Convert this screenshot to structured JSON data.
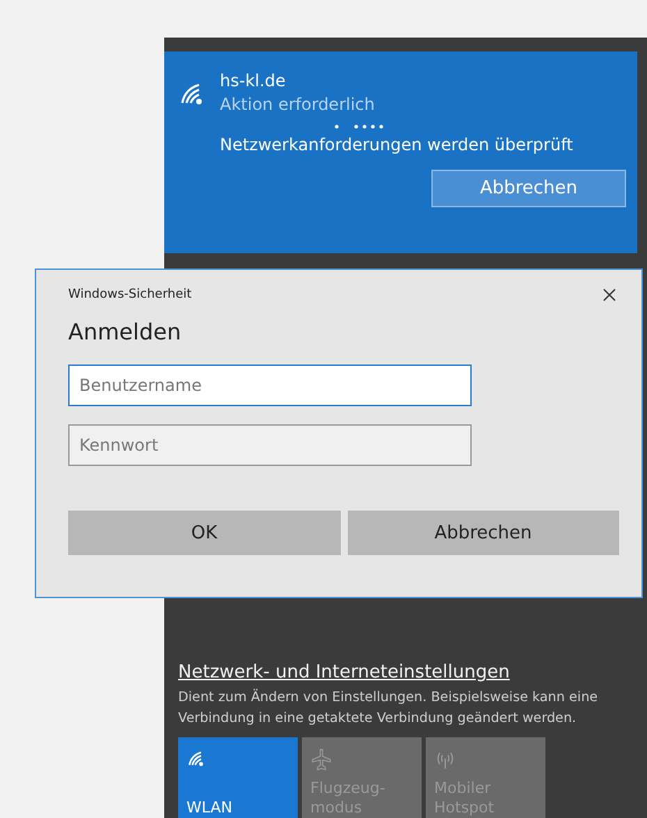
{
  "network": {
    "name": "hs-kl.de",
    "status": "Aktion erforderlich",
    "message": "Netzwerkanforderungen werden überprüft",
    "button": "Abbrechen"
  },
  "dialog": {
    "title": "Windows-Sicherheit",
    "heading": "Anmelden",
    "fields": [
      {
        "placeholder": "Benutzername",
        "focused": true
      },
      {
        "placeholder": "Kennwort",
        "focused": false
      }
    ],
    "buttons": [
      "OK",
      "Abbrechen"
    ]
  },
  "settings": {
    "link": "Netzwerk- und Interneteinstellungen",
    "description": "Dient zum Ändern von Einstellungen. Beispielsweise kann eine Verbindung in eine getaktete Verbindung geändert werden."
  },
  "tiles": [
    {
      "kind": "wlan",
      "label": "WLAN",
      "on": true
    },
    {
      "kind": "airplane",
      "label": "Flugzeug-modus",
      "on": false
    },
    {
      "kind": "hotspot",
      "label": "Mobiler Hotspot",
      "on": false
    }
  ]
}
